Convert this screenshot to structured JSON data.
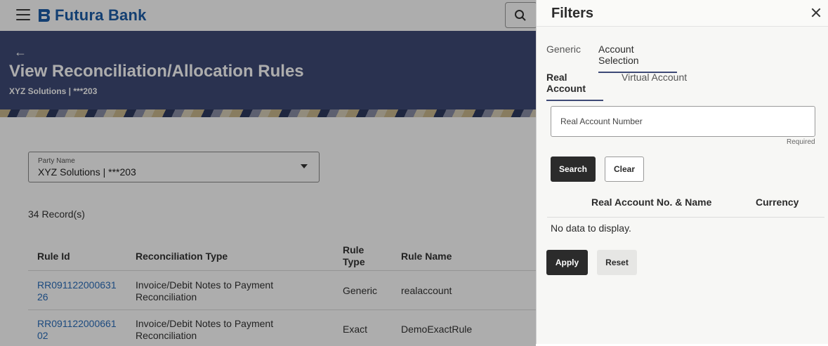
{
  "header": {
    "brand": "Futura Bank"
  },
  "page": {
    "back_label": "←",
    "title": "View Reconciliation/Allocation Rules",
    "subtitle": "XYZ Solutions | ***203"
  },
  "party": {
    "label": "Party Name",
    "value": "XYZ Solutions | ***203"
  },
  "records": "34 Record(s)",
  "table": {
    "headers": [
      "Rule Id",
      "Reconciliation Type",
      "Rule\nType",
      "Rule Name"
    ],
    "rows": [
      {
        "rule_id_1": "RR091122000631",
        "rule_id_2": "26",
        "recon_1": "Invoice/Debit Notes to Payment",
        "recon_2": "Reconciliation",
        "rule_type": "Generic",
        "rule_name": "realaccount"
      },
      {
        "rule_id_1": "RR091122000661",
        "rule_id_2": "02",
        "recon_1": "Invoice/Debit Notes to Payment",
        "recon_2": "Reconciliation",
        "rule_type": "Exact",
        "rule_name": "DemoExactRule"
      }
    ]
  },
  "filters": {
    "title": "Filters",
    "tabs": [
      "Generic",
      "Account Selection"
    ],
    "subtabs": [
      "Real Account",
      "Virtual Account"
    ],
    "account_placeholder": "Real Account Number",
    "required_label": "Required",
    "search_label": "Search",
    "clear_label": "Clear",
    "col_account": "Real Account No. & Name",
    "col_currency": "Currency",
    "no_data": "No data to display.",
    "apply_label": "Apply",
    "reset_label": "Reset"
  },
  "colors": {
    "brand": "#1c5ea9",
    "banner": "#3e4a76",
    "link": "#2a6ebb",
    "primary_button": "#2b2b2b"
  }
}
